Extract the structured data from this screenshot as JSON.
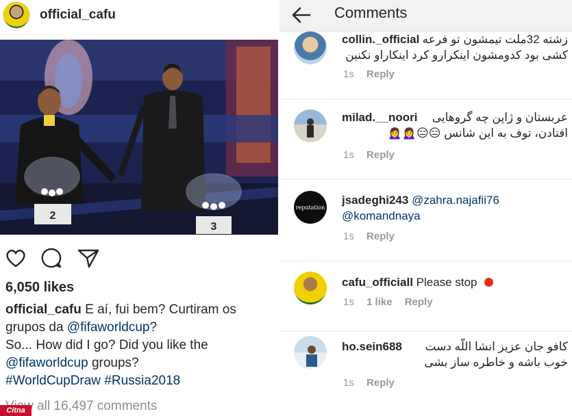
{
  "post": {
    "username": "official_cafu",
    "likes": "6,050 likes",
    "caption_user": "official_cafu",
    "caption_line1": "E aí, fui bem? Curtiram os",
    "caption_line2_pre": "grupos da ",
    "caption_mention": "@fifaworldcup",
    "caption_line2_post": "?",
    "caption_line3": "So... How did I go? Did you like the",
    "caption_mention2": "@fifaworldcup",
    "caption_line4_post": " groups?",
    "hashtags": "#WorldCupDraw #Russia2018",
    "view_all": "View all 16,497 comments",
    "pot2_label": "2",
    "pot3_label": "3"
  },
  "watermark": "Citna",
  "comments_header": {
    "title": "Comments"
  },
  "comments": [
    {
      "username": "collin._official",
      "text_line1": "زشته 32ملت تیمشون تو فرعه",
      "text_line2": "کشی بود کدومشون اینکرارو کرد اینکاراو نکنین",
      "time": "1s",
      "likes": "",
      "reply": "Reply"
    },
    {
      "username": "milad.__noori",
      "text_line1": "عربستان و ژاپن چه گروهایی",
      "text_line2": "افتادن، توف به این شانس 😑😑🙍‍♀️🙍‍♀️",
      "time": "1s",
      "likes": "",
      "reply": "Reply"
    },
    {
      "username": "jsadeghi243",
      "mention1": "@zahra.najafii76",
      "mention2": "@komandnaya",
      "avatar_text": "reputation",
      "time": "1s",
      "likes": "",
      "reply": "Reply"
    },
    {
      "username": "cafu_officiall",
      "text_line1": "Please stop",
      "time": "1s",
      "likes": "1 like",
      "reply": "Reply"
    },
    {
      "username": "ho.sein688",
      "text_line1": "کافو جان عزیز انشا اللّه دست",
      "text_line2": "خوب باشه و خاطره ساز بشی",
      "time": "1s",
      "likes": "",
      "reply": "Reply"
    }
  ],
  "colors": {
    "link": "#003569",
    "muted": "#999999",
    "stop_dot": "#e0301e",
    "watermark_bg": "#c8102e"
  },
  "icons": [
    "heart-icon",
    "comment-icon",
    "share-icon",
    "back-arrow-icon",
    "red-circle-icon"
  ]
}
